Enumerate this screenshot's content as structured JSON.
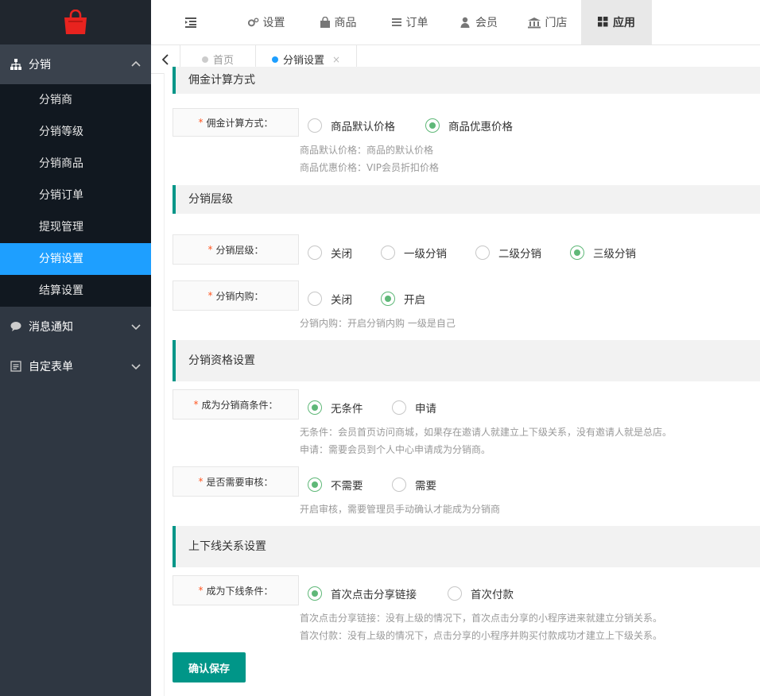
{
  "sidebar": {
    "groups": [
      {
        "label": "分销",
        "icon": "sitemap-icon",
        "open": true
      },
      {
        "label": "消息通知",
        "icon": "chat-bubble-icon"
      },
      {
        "label": "自定表单",
        "icon": "form-icon"
      }
    ],
    "items": [
      "分销商",
      "分销等级",
      "分销商品",
      "分销订单",
      "提现管理",
      "分销设置",
      "结算设置"
    ],
    "active_item": "分销设置"
  },
  "topnav": {
    "items": [
      {
        "label": "设置",
        "icon": "gears-icon"
      },
      {
        "label": "商品",
        "icon": "shopping-bag-icon"
      },
      {
        "label": "订单",
        "icon": "list-icon"
      },
      {
        "label": "会员",
        "icon": "user-icon"
      },
      {
        "label": "门店",
        "icon": "bank-icon"
      },
      {
        "label": "应用",
        "icon": "apps-grid-icon"
      }
    ],
    "active": "应用"
  },
  "tabs": [
    {
      "label": "首页"
    },
    {
      "label": "分销设置",
      "active": true,
      "close": "×"
    }
  ],
  "sections": {
    "commission": {
      "title": "佣金计算方式",
      "label": "佣金计算方式：",
      "options": [
        "商品默认价格",
        "商品优惠价格"
      ],
      "selected": "商品优惠价格",
      "hints": [
        "商品默认价格：商品的默认价格",
        "商品优惠价格：VIP会员折扣价格"
      ]
    },
    "level": {
      "title": "分销层级",
      "level_label": "分销层级：",
      "level_options": [
        "关闭",
        "一级分销",
        "二级分销",
        "三级分销"
      ],
      "level_selected": "三级分销",
      "self_label": "分销内购：",
      "self_options": [
        "关闭",
        "开启"
      ],
      "self_selected": "开启",
      "self_hint": "分销内购：开启分销内购 一级是自己"
    },
    "qualification": {
      "title": "分销资格设置",
      "cond_label": "成为分销商条件：",
      "cond_options": [
        "无条件",
        "申请"
      ],
      "cond_selected": "无条件",
      "cond_hints": [
        "无条件：会员首页访问商城，如果存在邀请人就建立上下级关系，没有邀请人就是总店。",
        "申请：需要会员到个人中心申请成为分销商。"
      ],
      "audit_label": "是否需要审核：",
      "audit_options": [
        "不需要",
        "需要"
      ],
      "audit_selected": "不需要",
      "audit_hint": "开启审核，需要管理员手动确认才能成为分销商"
    },
    "relation": {
      "title": "上下线关系设置",
      "label": "成为下线条件：",
      "options": [
        "首次点击分享链接",
        "首次付款"
      ],
      "selected": "首次点击分享链接",
      "hints": [
        "首次点击分享链接：没有上级的情况下，首次点击分享的小程序进来就建立分销关系。",
        "首次付款：没有上级的情况下，点击分享的小程序并购买付款成功才建立上下级关系。"
      ]
    }
  },
  "buttons": {
    "save": "确认保存"
  },
  "required_mark": "*",
  "colors": {
    "accent": "#009688",
    "active_blue": "#1e9fff",
    "radio_green": "#5fb878",
    "sidebar_bg": "#2f3742"
  }
}
